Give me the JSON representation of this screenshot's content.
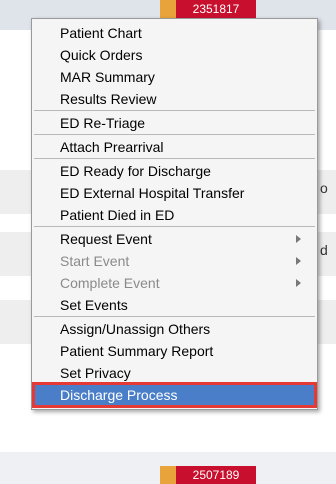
{
  "background": {
    "top_badge": "2351817",
    "bottom_badge": "2507189",
    "fragments": [
      "o",
      "d"
    ]
  },
  "menu": {
    "items": [
      {
        "label": "Patient Chart"
      },
      {
        "label": "Quick Orders"
      },
      {
        "label": "MAR Summary"
      },
      {
        "label": "Results Review",
        "sep_after": true
      },
      {
        "label": "ED Re-Triage",
        "sep_after": true
      },
      {
        "label": "Attach Prearrival",
        "sep_after": true
      },
      {
        "label": "ED Ready for Discharge"
      },
      {
        "label": "ED External Hospital Transfer"
      },
      {
        "label": "Patient Died in ED",
        "sep_after": true
      },
      {
        "label": "Request Event",
        "submenu": true
      },
      {
        "label": "Start Event",
        "submenu": true,
        "disabled": true
      },
      {
        "label": "Complete Event",
        "submenu": true,
        "disabled": true
      },
      {
        "label": "Set Events",
        "sep_after": true
      },
      {
        "label": "Assign/Unassign Others"
      },
      {
        "label": "Patient Summary Report"
      },
      {
        "label": "Set Privacy"
      },
      {
        "label": "Discharge Process",
        "selected": true
      }
    ]
  },
  "colors": {
    "selection": "#4a7ec8",
    "highlight_outline": "#e53935",
    "badge_red": "#c8102e"
  }
}
